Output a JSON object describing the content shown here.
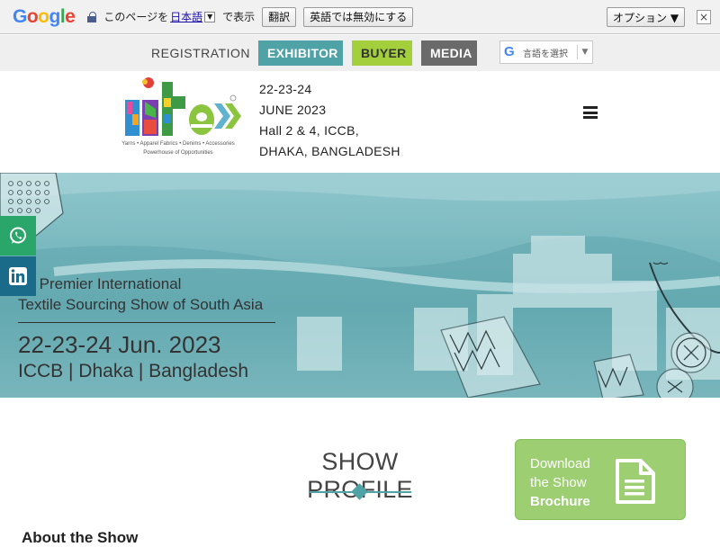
{
  "translate_bar": {
    "logo": "Google",
    "prefix": "このページを",
    "language": "日本語",
    "suffix": "で表示",
    "translate_button": "翻訳",
    "never_button": "英語では無効にする",
    "options_button": "オプション ▼",
    "close": "×"
  },
  "topnav": {
    "registration": "REGISTRATION",
    "exhibitor": "EXHIBITOR",
    "buyer": "BUYER",
    "media": "MEDIA",
    "language_select": "言語を選択"
  },
  "header": {
    "logo_tagline_1": "Yarns • Apparel Fabrics • Denims • Accessories",
    "logo_tagline_2": "Powerhouse of Opportunities",
    "event_lines": [
      "22-23-24",
      "JUNE 2023",
      "Hall 2 & 4, ICCB,",
      "DHAKA, BANGLADESH"
    ]
  },
  "hero": {
    "line1": "he Premier International",
    "line2": "Textile Sourcing Show of South Asia",
    "dates": "22-23-24 Jun. 2023",
    "venue": "ICCB | Dhaka | Bangladesh"
  },
  "show_profile": {
    "title": "SHOW PROFILE",
    "brochure": [
      "Download",
      "the Show",
      "Brochure"
    ]
  },
  "about": {
    "heading": "About the Show"
  },
  "colors": {
    "teal": "#4fa2a6",
    "buyer_green": "#a2cf3b",
    "media_gray": "#6a6a6a",
    "brochure_green": "#9dcf72",
    "whatsapp": "#2aa66a",
    "linkedin": "#1a6a8a"
  }
}
